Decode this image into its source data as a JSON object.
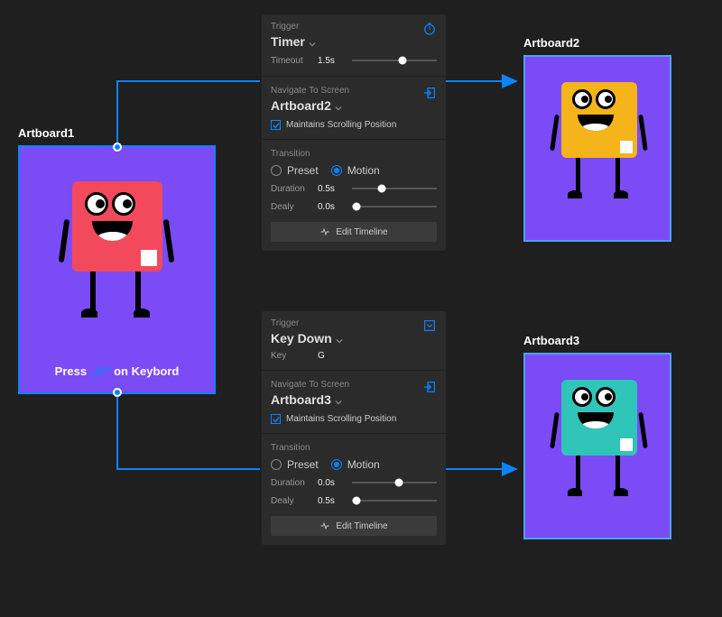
{
  "artboard1": {
    "label": "Artboard1",
    "caption_pre": "Press ",
    "caption_hl": "G",
    "caption_post": " on Keybord"
  },
  "artboard2": {
    "label": "Artboard2"
  },
  "artboard3": {
    "label": "Artboard3"
  },
  "panel1": {
    "trigger": {
      "section": "Trigger",
      "value": "Timer",
      "timeout_label": "Timeout",
      "timeout_value": "1.5s",
      "slider_pct": 60
    },
    "navigate": {
      "section": "Navigate To Screen",
      "value": "Artboard2",
      "checkbox": "Maintains Scrolling Position",
      "checked": true
    },
    "transition": {
      "section": "Transition",
      "options": {
        "preset": "Preset",
        "motion": "Motion"
      },
      "selected": "motion",
      "duration_label": "Duration",
      "duration_value": "0.5s",
      "duration_pct": 35,
      "delay_label": "Dealy",
      "delay_value": "0.0s",
      "delay_pct": 5,
      "button": "Edit Timeline"
    }
  },
  "panel2": {
    "trigger": {
      "section": "Trigger",
      "value": "Key Down",
      "key_label": "Key",
      "key_value": "G"
    },
    "navigate": {
      "section": "Navigate To Screen",
      "value": "Artboard3",
      "checkbox": "Maintains Scrolling Position",
      "checked": true
    },
    "transition": {
      "section": "Transition",
      "options": {
        "preset": "Preset",
        "motion": "Motion"
      },
      "selected": "motion",
      "duration_label": "Duration",
      "duration_value": "0.0s",
      "duration_pct": 55,
      "delay_label": "Dealy",
      "delay_value": "0.5s",
      "delay_pct": 5,
      "button": "Edit Timeline"
    }
  }
}
